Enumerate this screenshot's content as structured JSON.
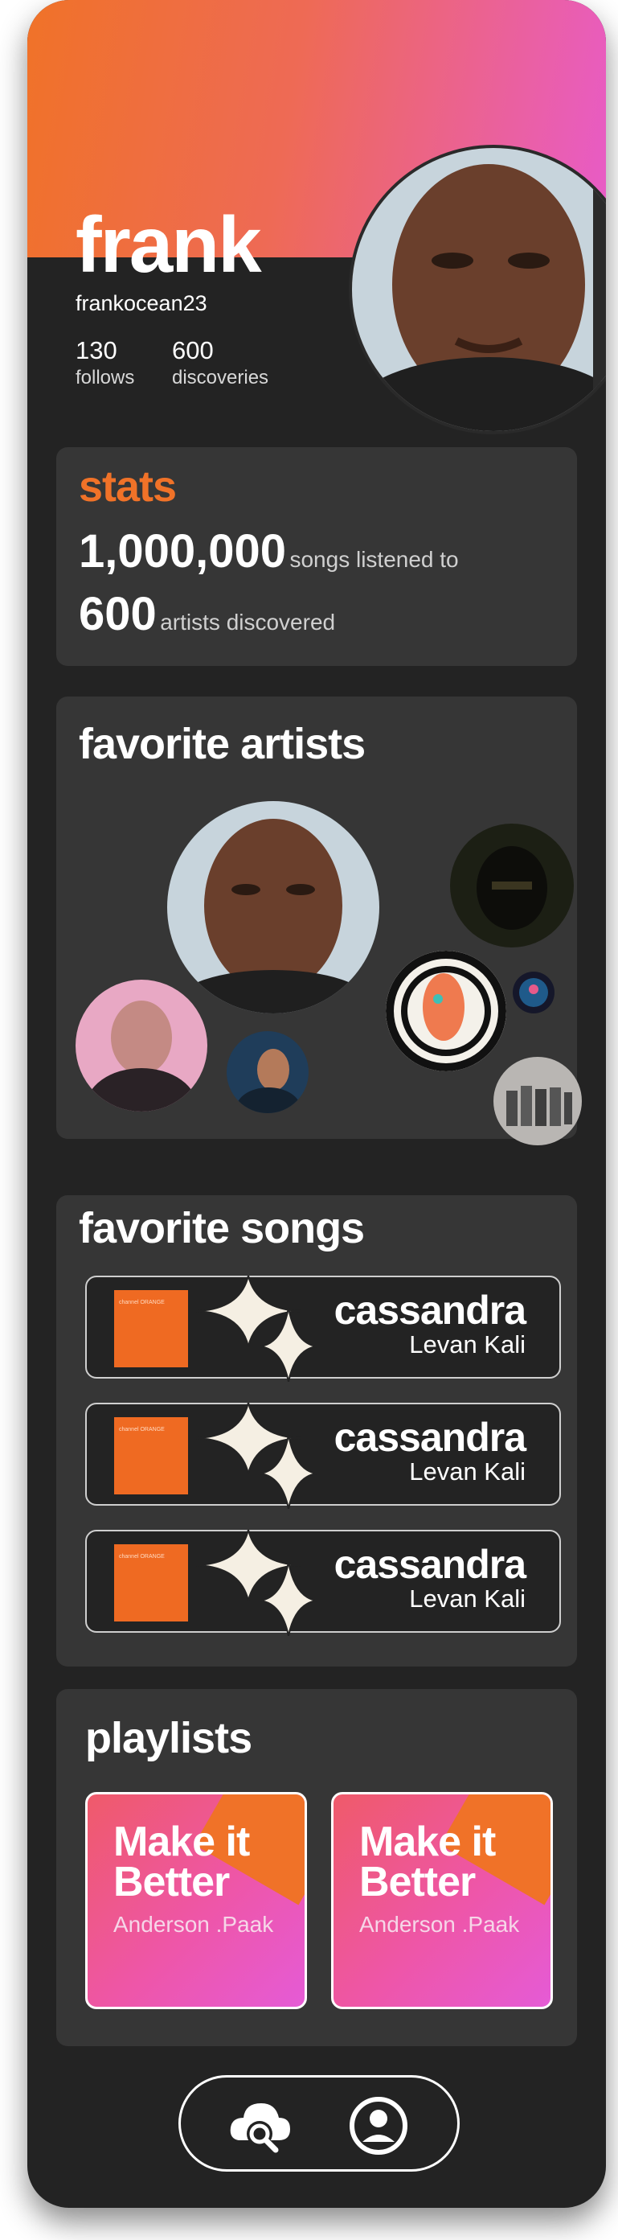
{
  "profile": {
    "name": "frank",
    "username": "frankocean23",
    "follows_count": "130",
    "follows_label": "follows",
    "discoveries_count": "600",
    "discoveries_label": "discoveries"
  },
  "stats": {
    "title": "stats",
    "songs_count": "1,000,000",
    "songs_label": "songs listened to",
    "artists_count": "600",
    "artists_label": "artists discovered"
  },
  "favorite_artists": {
    "title": "favorite artists"
  },
  "favorite_songs": {
    "title": "favorite songs",
    "items": [
      {
        "title": "cassandra",
        "artist": "Levan Kali",
        "cover_text": "channel ORANGE"
      },
      {
        "title": "cassandra",
        "artist": "Levan Kali",
        "cover_text": "channel ORANGE"
      },
      {
        "title": "cassandra",
        "artist": "Levan Kali",
        "cover_text": "channel ORANGE"
      }
    ]
  },
  "playlists": {
    "title": "playlists",
    "items": [
      {
        "title_line1": "Make it",
        "title_line2": "Better",
        "artist": "Anderson .Paak"
      },
      {
        "title_line1": "Make it",
        "title_line2": "Better",
        "artist": "Anderson .Paak"
      }
    ]
  },
  "nav": {
    "icons": [
      "cloud-search-icon",
      "profile-icon"
    ]
  },
  "colors": {
    "accent_orange": "#f07228",
    "accent_pink": "#e85bc9",
    "background": "#232323",
    "card": "#363636"
  }
}
